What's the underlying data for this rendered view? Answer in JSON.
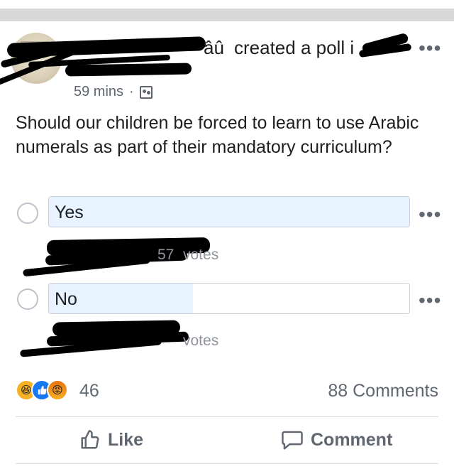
{
  "post": {
    "author_suffix": "âû",
    "action_text": "created a poll i",
    "timestamp": "59 mins",
    "separator": "·",
    "audience_icon": "group-icon",
    "more_label": "•••"
  },
  "question": "Should our children be forced to learn to use Arabic numerals as part of their mandatory curriculum?",
  "poll": {
    "options": [
      {
        "label": "Yes",
        "votes_text": "votes",
        "votes_partial": "57",
        "fill_fraction": 1.0
      },
      {
        "label": "No",
        "votes_text": "votes",
        "fill_fraction": 0.4
      }
    ]
  },
  "footer": {
    "reactions": [
      "haha-icon",
      "like-icon",
      "angry-icon"
    ],
    "reaction_count": "46",
    "comments": "88 Comments",
    "like_label": "Like",
    "comment_label": "Comment"
  },
  "colors": {
    "poll_fill": "#e7f3ff",
    "muted_text": "#606770",
    "like_blue": "#1877f2"
  }
}
